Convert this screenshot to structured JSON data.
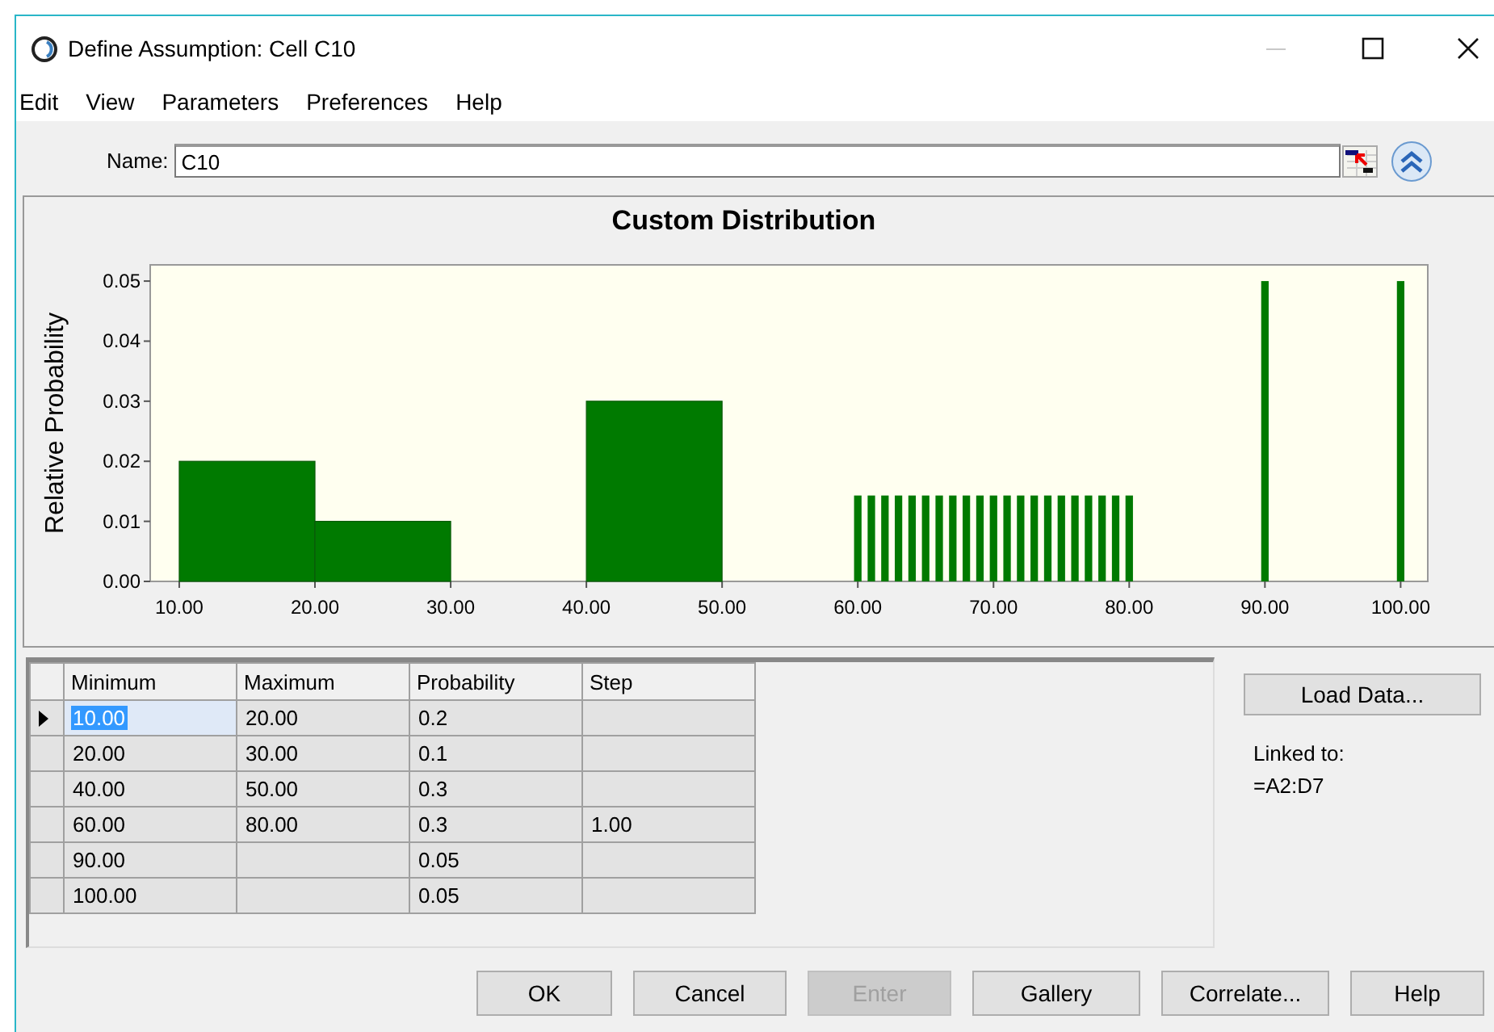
{
  "window": {
    "title": "Define Assumption: Cell C10"
  },
  "menu": [
    {
      "label": "Edit"
    },
    {
      "label": "View"
    },
    {
      "label": "Parameters"
    },
    {
      "label": "Preferences"
    },
    {
      "label": "Help"
    }
  ],
  "name_field": {
    "label": "Name:",
    "value": "C10"
  },
  "chart": {
    "chart_data": {
      "type": "bar",
      "title": "Custom Distribution",
      "ylabel": "Relative Probability",
      "x": [
        15,
        25,
        45,
        60,
        61,
        62,
        63,
        64,
        65,
        66,
        67,
        68,
        69,
        70,
        71,
        72,
        73,
        74,
        75,
        76,
        77,
        78,
        79,
        80,
        90,
        100
      ],
      "series": [
        {
          "color": "#007a00",
          "values": [
            0.02,
            0.01,
            0.03,
            null,
            null,
            null,
            null,
            null,
            null,
            null,
            null,
            null,
            null,
            null,
            null,
            null,
            null,
            null,
            null,
            null,
            null,
            null,
            null,
            null,
            null,
            null
          ]
        },
        {
          "color": "#007a00",
          "values": [
            null,
            null,
            null,
            0.0143,
            0.0143,
            0.0143,
            0.0143,
            0.0143,
            0.0143,
            0.0143,
            0.0143,
            0.0143,
            0.0143,
            0.0143,
            0.0143,
            0.0143,
            0.0143,
            0.0143,
            0.0143,
            0.0143,
            0.0143,
            0.0143,
            0.0143,
            0.0143,
            0.05,
            0.05
          ]
        }
      ],
      "xlim": [
        7.86,
        102
      ],
      "ylim": [
        0,
        0.0527
      ],
      "xticks": [
        {
          "value": 10,
          "label": "10.00"
        },
        {
          "value": 20,
          "label": "20.00"
        },
        {
          "value": 30,
          "label": "30.00"
        },
        {
          "value": 40,
          "label": "40.00"
        },
        {
          "value": 50,
          "label": "50.00"
        },
        {
          "value": 60,
          "label": "60.00"
        },
        {
          "value": 70,
          "label": "70.00"
        },
        {
          "value": 80,
          "label": "80.00"
        },
        {
          "value": 90,
          "label": "90.00"
        },
        {
          "value": 100,
          "label": "100.00"
        }
      ],
      "yticks": [
        {
          "value": 0,
          "label": "0.00"
        },
        {
          "value": 0.01,
          "label": "0.01"
        },
        {
          "value": 0.02,
          "label": "0.02"
        },
        {
          "value": 0.03,
          "label": "0.03"
        },
        {
          "value": 0.04,
          "label": "0.04"
        },
        {
          "value": 0.05,
          "label": "0.05"
        }
      ]
    }
  },
  "table": {
    "columns": [
      "Minimum",
      "Maximum",
      "Probability",
      "Step"
    ],
    "rows": [
      {
        "current": true,
        "cells": [
          {
            "text": "10.00",
            "selected": true
          },
          {
            "text": "20.00",
            "selected": false
          },
          {
            "text": "0.2",
            "selected": false
          },
          {
            "text": null,
            "selected": false
          }
        ]
      },
      {
        "current": false,
        "cells": [
          {
            "text": "20.00",
            "selected": false
          },
          {
            "text": "30.00",
            "selected": false
          },
          {
            "text": "0.1",
            "selected": false
          },
          {
            "text": null,
            "selected": false
          }
        ]
      },
      {
        "current": false,
        "cells": [
          {
            "text": "40.00",
            "selected": false
          },
          {
            "text": "50.00",
            "selected": false
          },
          {
            "text": "0.3",
            "selected": false
          },
          {
            "text": null,
            "selected": false
          }
        ]
      },
      {
        "current": false,
        "cells": [
          {
            "text": "60.00",
            "selected": false
          },
          {
            "text": "80.00",
            "selected": false
          },
          {
            "text": "0.3",
            "selected": false
          },
          {
            "text": "1.00",
            "selected": false
          }
        ]
      },
      {
        "current": false,
        "cells": [
          {
            "text": "90.00",
            "selected": false
          },
          {
            "text": null,
            "selected": false
          },
          {
            "text": "0.05",
            "selected": false
          },
          {
            "text": null,
            "selected": false
          }
        ]
      },
      {
        "current": false,
        "cells": [
          {
            "text": "100.00",
            "selected": false
          },
          {
            "text": null,
            "selected": false
          },
          {
            "text": "0.05",
            "selected": false
          },
          {
            "text": null,
            "selected": false
          }
        ]
      }
    ]
  },
  "side": {
    "load_button": "Load Data...",
    "linked_label": "Linked to:",
    "linked_value": "=A2:D7"
  },
  "buttons": [
    {
      "label": "OK",
      "disabled": false
    },
    {
      "label": "Cancel",
      "disabled": false
    },
    {
      "label": "Enter",
      "disabled": true
    },
    {
      "label": "Gallery",
      "disabled": false
    },
    {
      "label": "Correlate...",
      "disabled": false
    },
    {
      "label": "Help",
      "disabled": false
    }
  ]
}
